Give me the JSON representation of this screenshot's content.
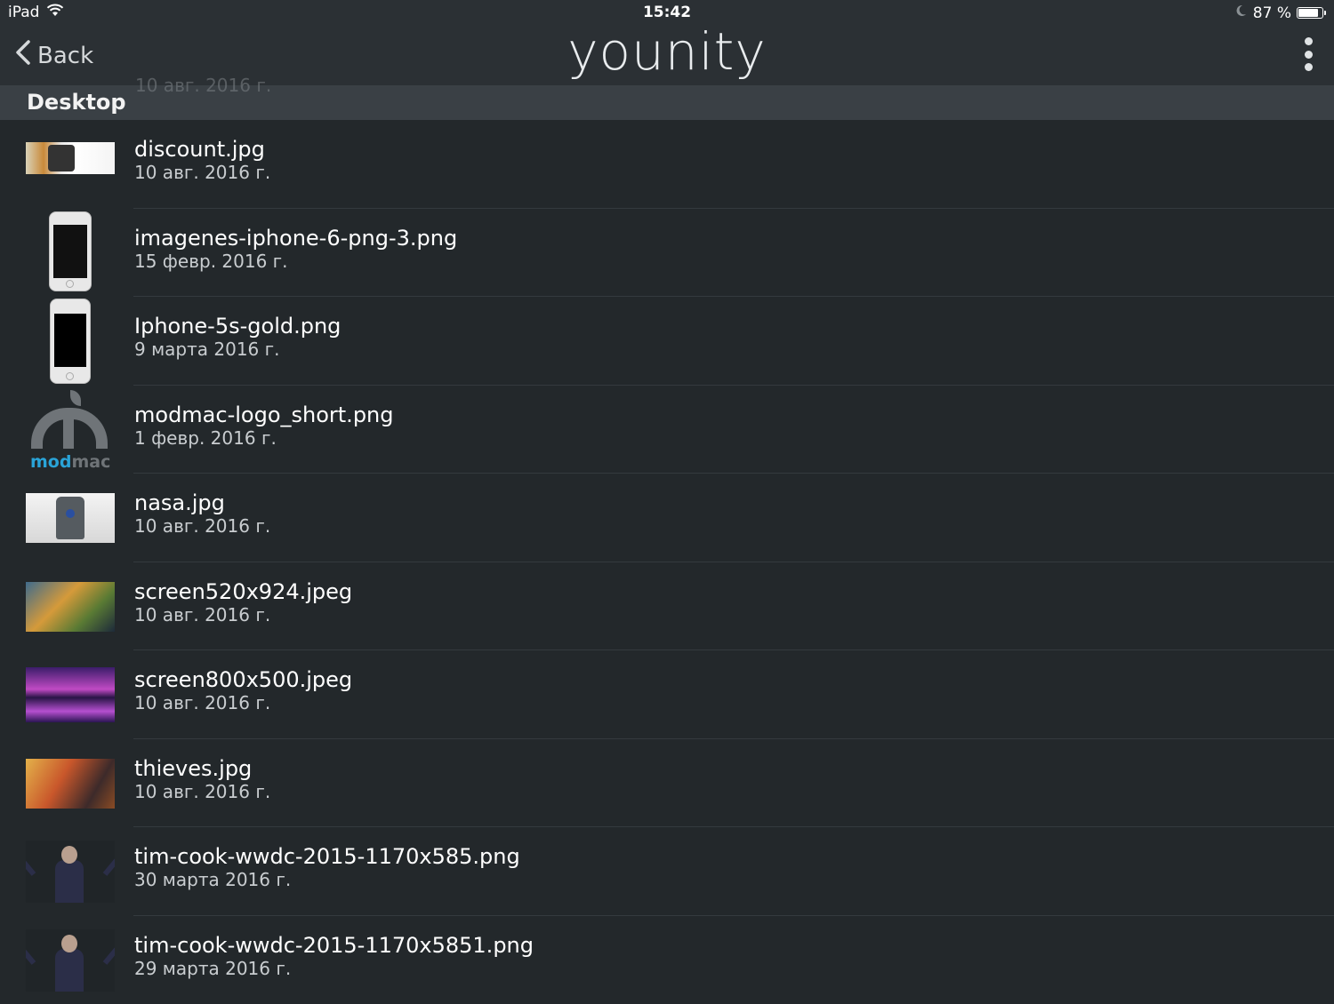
{
  "status_bar": {
    "device": "iPad",
    "time": "15:42",
    "battery_text": "87 %",
    "battery_level": 0.87
  },
  "nav": {
    "back_label": "Back",
    "app_logo": "younity"
  },
  "section": {
    "title": "Desktop",
    "ghost_text": "10 авг. 2016 г."
  },
  "files": [
    {
      "name": "discount.jpg",
      "date": "10 авг. 2016 г."
    },
    {
      "name": "imagenes-iphone-6-png-3.png",
      "date": "15 февр. 2016 г."
    },
    {
      "name": "Iphone-5s-gold.png",
      "date": "9 марта 2016 г."
    },
    {
      "name": "modmac-logo_short.png",
      "date": "1 февр. 2016 г."
    },
    {
      "name": "nasa.jpg",
      "date": "10 авг. 2016 г."
    },
    {
      "name": "screen520x924.jpeg",
      "date": "10 авг. 2016 г."
    },
    {
      "name": "screen800x500.jpeg",
      "date": "10 авг. 2016 г."
    },
    {
      "name": "thieves.jpg",
      "date": "10 авг. 2016 г."
    },
    {
      "name": "tim-cook-wwdc-2015-1170x585.png",
      "date": "30 марта 2016 г."
    },
    {
      "name": "tim-cook-wwdc-2015-1170x5851.png",
      "date": "29 марта 2016 г."
    }
  ],
  "thumbnails": {
    "modmac_word_a": "mod",
    "modmac_word_b": "mac"
  },
  "colors": {
    "background": "#23282b",
    "topbar": "#2b3034",
    "section_header": "#3a4045",
    "separator": "#343a3e",
    "modmac_blue": "#2aa4d8"
  },
  "icons": [
    "wifi-icon",
    "moon-icon",
    "battery-icon",
    "chevron-left-icon",
    "more-vertical-icon"
  ]
}
